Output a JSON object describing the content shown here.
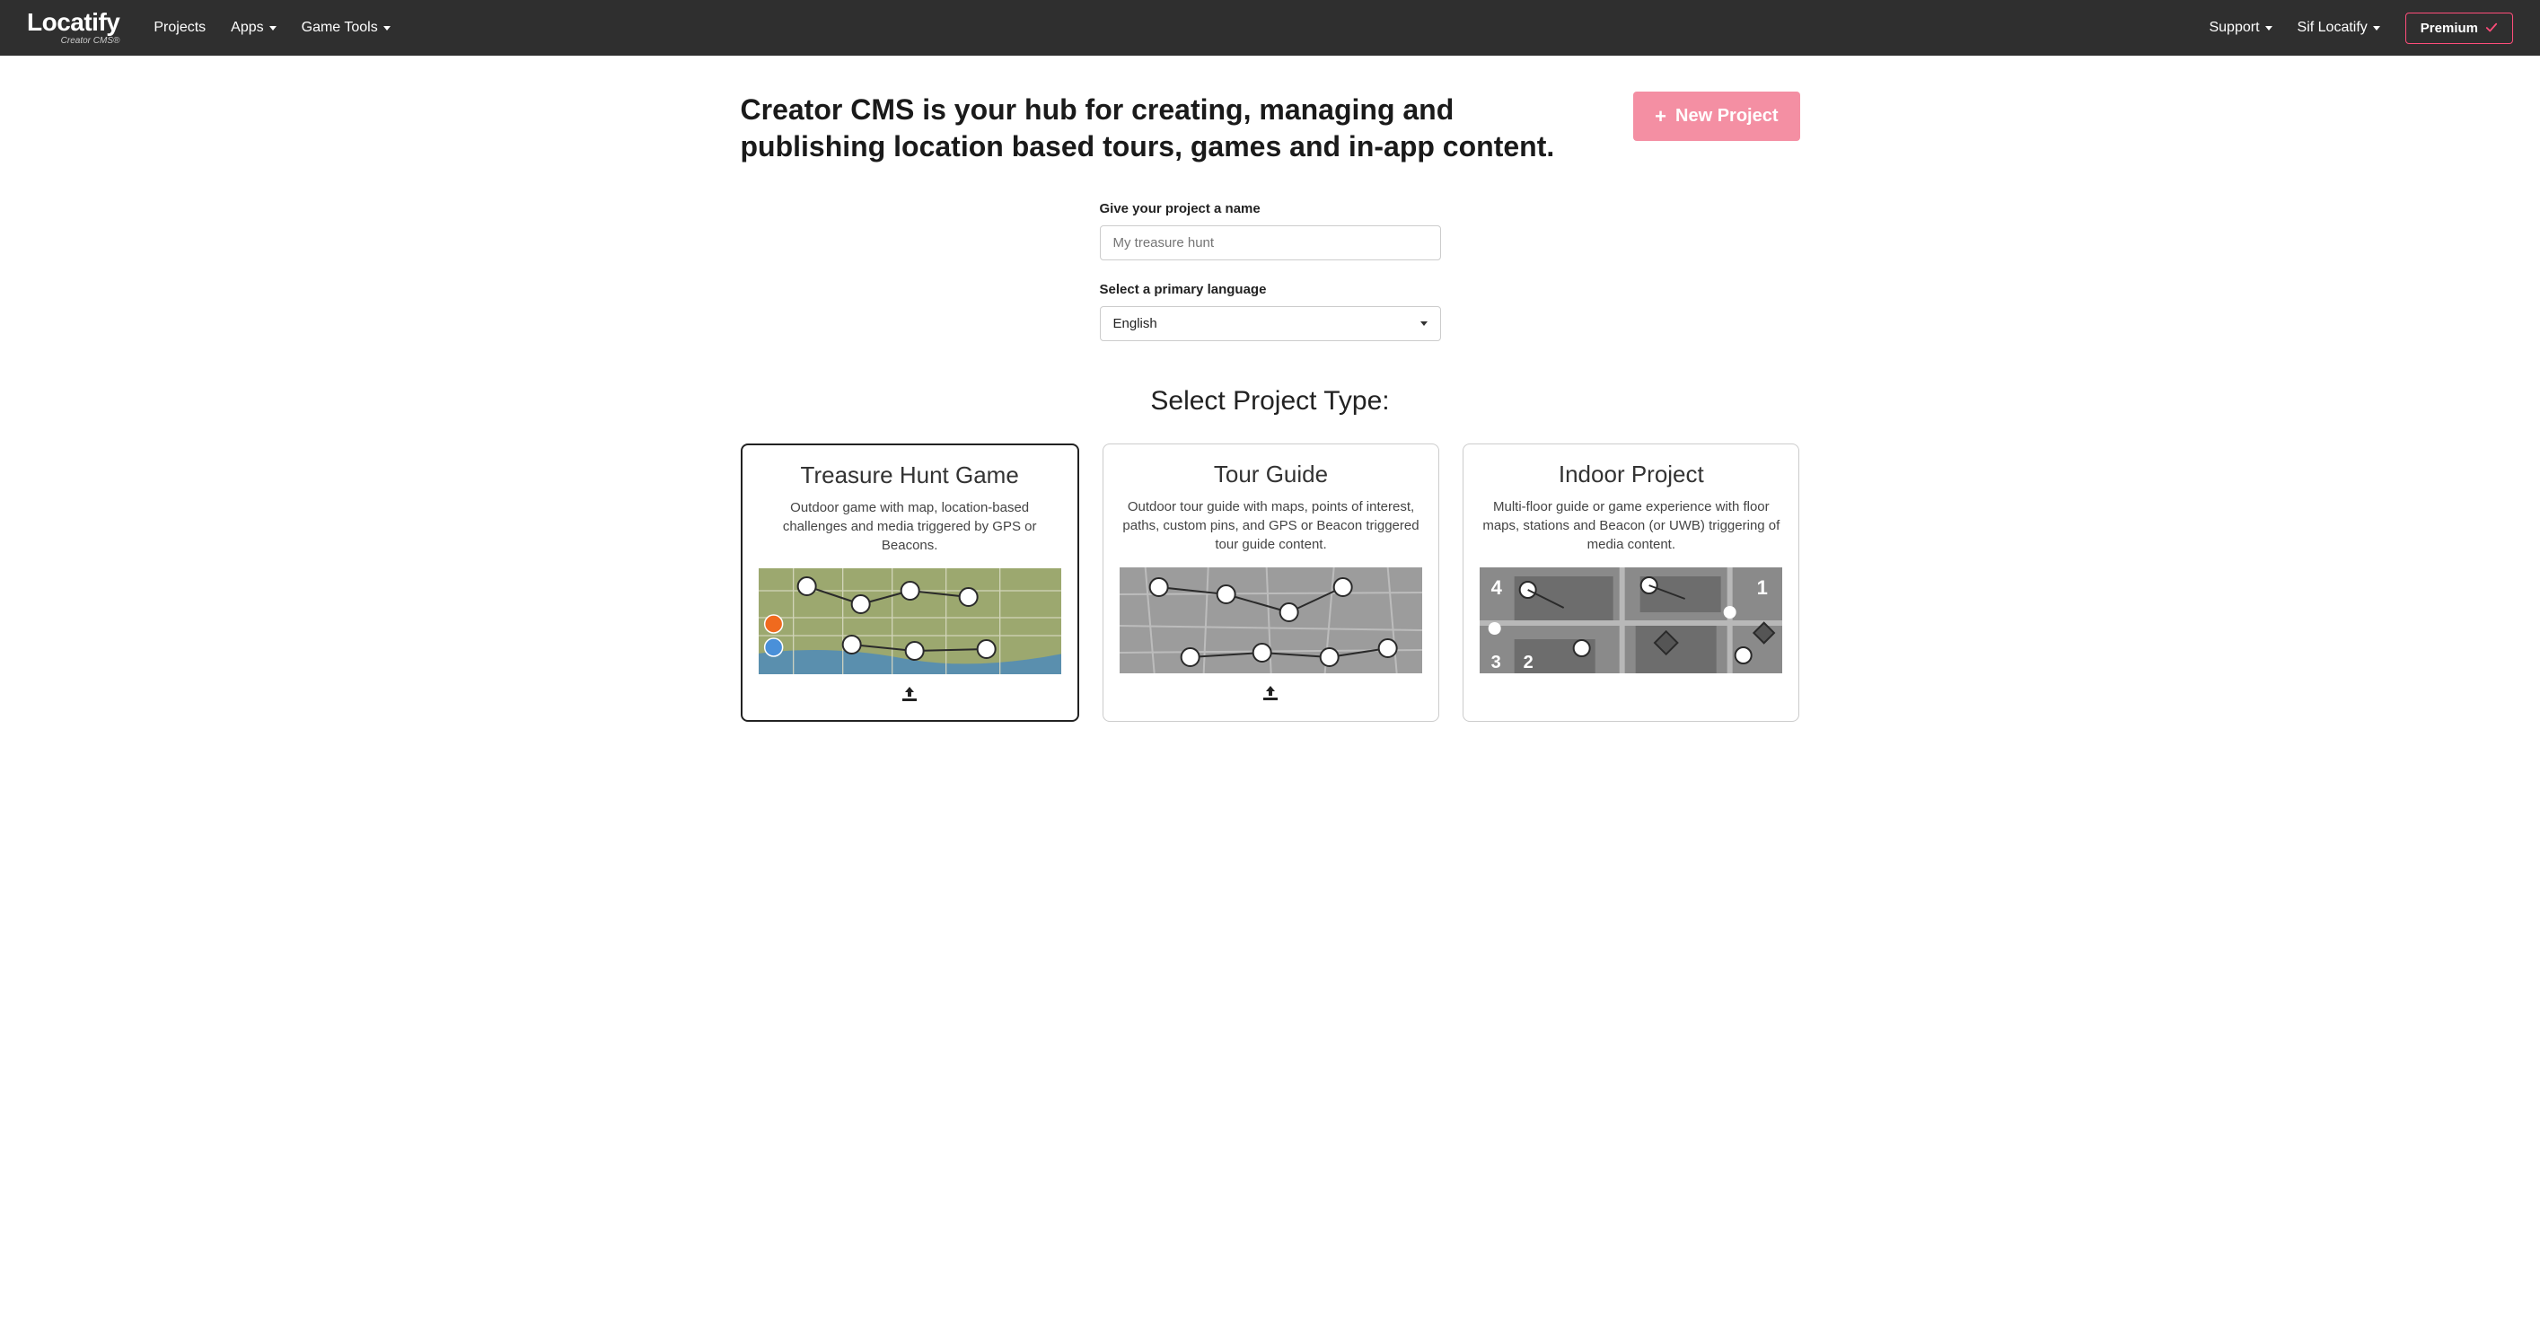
{
  "nav": {
    "brand_main": "Locatify",
    "brand_sub": "Creator CMS®",
    "links": {
      "projects": "Projects",
      "apps": "Apps",
      "game_tools": "Game Tools"
    },
    "support": "Support",
    "user": "Sif Locatify",
    "premium": "Premium"
  },
  "hero": {
    "title": "Creator CMS is your hub for creating, managing and publishing location based tours, games and in-app content.",
    "new_project_label": "New Project"
  },
  "form": {
    "name_label": "Give your project a name",
    "name_placeholder": "My treasure hunt",
    "lang_label": "Select a primary language",
    "lang_value": "English"
  },
  "section": {
    "title": "Select Project Type:"
  },
  "cards": [
    {
      "title": "Treasure Hunt Game",
      "desc": "Outdoor game with map, location-based challenges and media triggered by GPS or Beacons."
    },
    {
      "title": "Tour Guide",
      "desc": "Outdoor tour guide with maps, points of interest, paths, custom pins, and GPS or Beacon triggered tour guide content."
    },
    {
      "title": "Indoor Project",
      "desc": "Multi-floor guide or game experience with floor maps, stations and Beacon (or UWB) triggering of media content."
    }
  ]
}
